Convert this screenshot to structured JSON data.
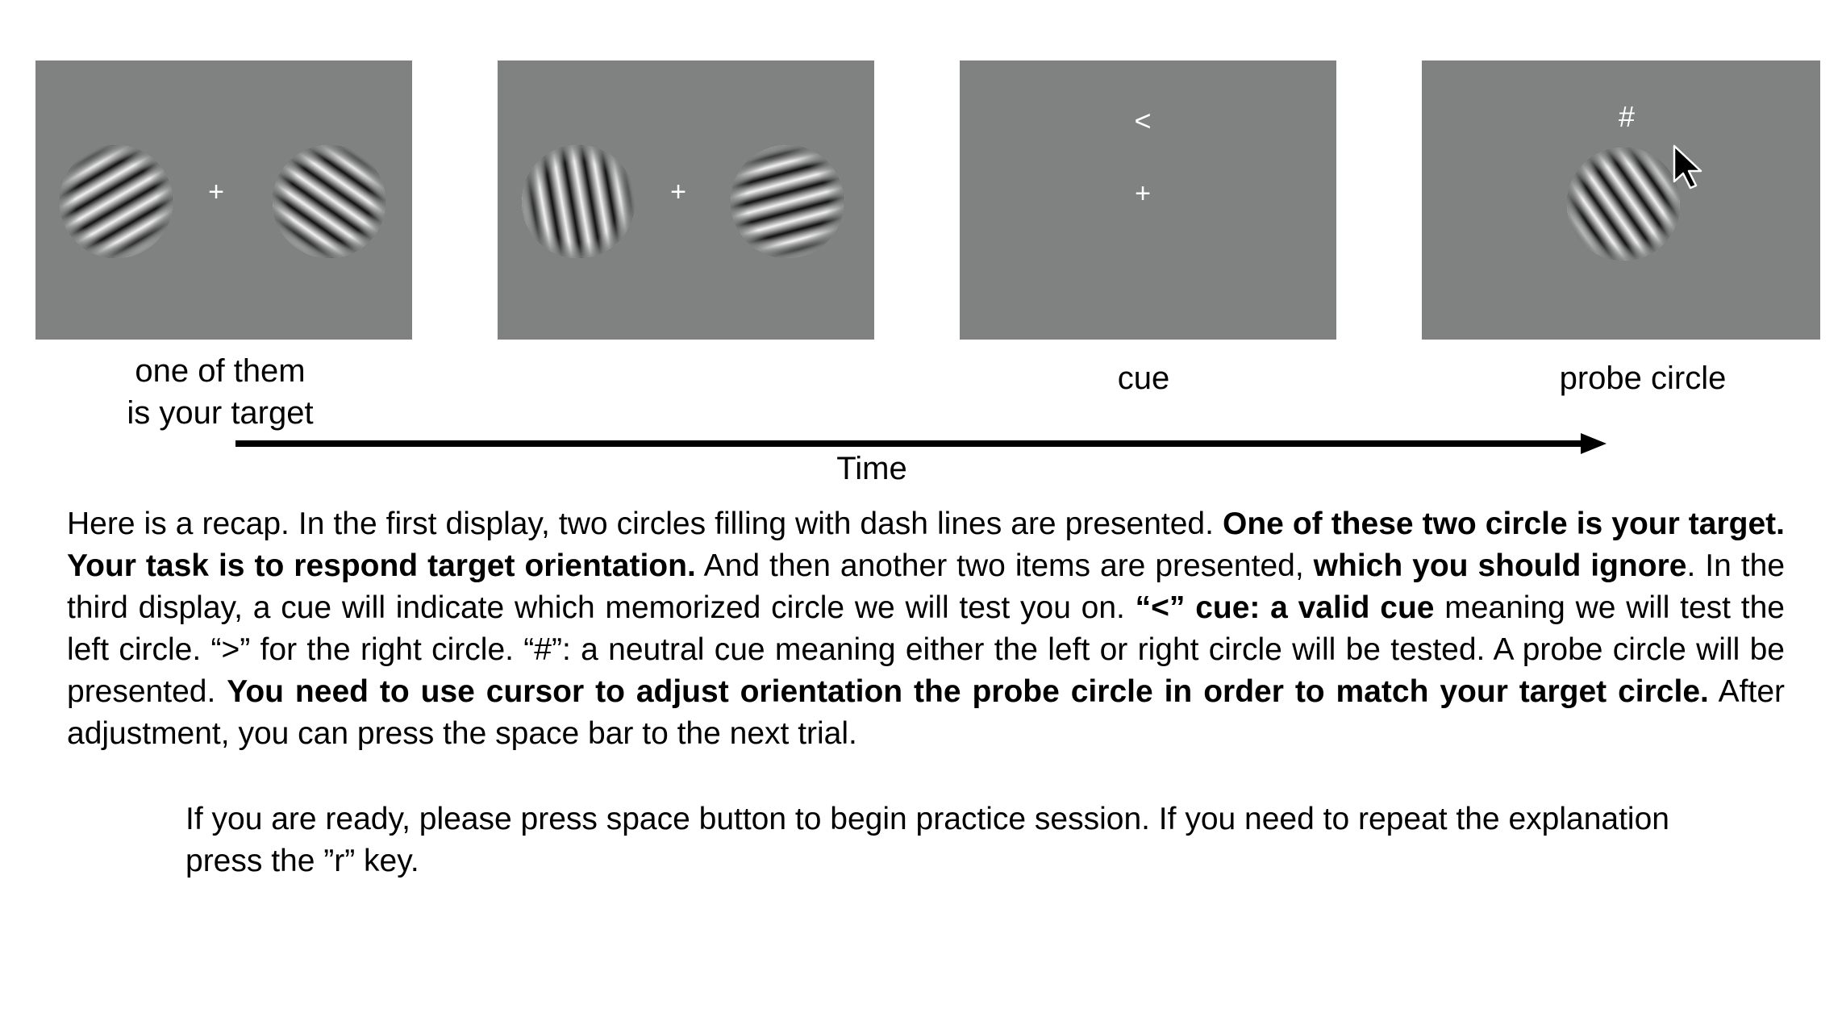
{
  "panels": [
    {
      "name": "encoding-display",
      "fixation": "+",
      "cue": "",
      "caption": "one of them\nis your target"
    },
    {
      "name": "distractor-display",
      "fixation": "+",
      "cue": "",
      "caption": ""
    },
    {
      "name": "cue-display",
      "fixation": "+",
      "cue": "<",
      "caption": "cue"
    },
    {
      "name": "probe-display",
      "fixation": "",
      "cue": "#",
      "caption": "probe circle"
    }
  ],
  "gratings": [
    {
      "panel": 0,
      "orientation_deg": 30
    },
    {
      "panel": 0,
      "orientation_deg": -35
    },
    {
      "panel": 1,
      "orientation_deg": -80
    },
    {
      "panel": 1,
      "orientation_deg": 15
    },
    {
      "panel": 3,
      "orientation_deg": -55
    }
  ],
  "timeline": {
    "label": "Time"
  },
  "recap": {
    "s1": "Here is a recap. In the first display, two circles filling with dash lines are presented. ",
    "s2": "One of these two circle is your target. Your task is to respond target orientation.",
    "s3": " And then another two items are presented, ",
    "s4": "which you should ignore",
    "s5": ". In the third display, a cue will indicate which memorized circle we will test you on. ",
    "s6": "“<” cue: a valid cue",
    "s7": " meaning we will test the left circle. “>” for the right circle. “#”: a neutral cue meaning either the left or right circle will be tested. A probe circle will be presented. ",
    "s8": "You need to use cursor to adjust orientation the probe circle in order to match your target circle.",
    "s9": " After adjustment, you can press the space bar to the next trial."
  },
  "ready_text": "If you are ready, please press space button to begin practice session. If you need to repeat the explanation press the ”r” key.",
  "colors": {
    "panel_bg": "#808282",
    "symbol": "#ffffff"
  }
}
